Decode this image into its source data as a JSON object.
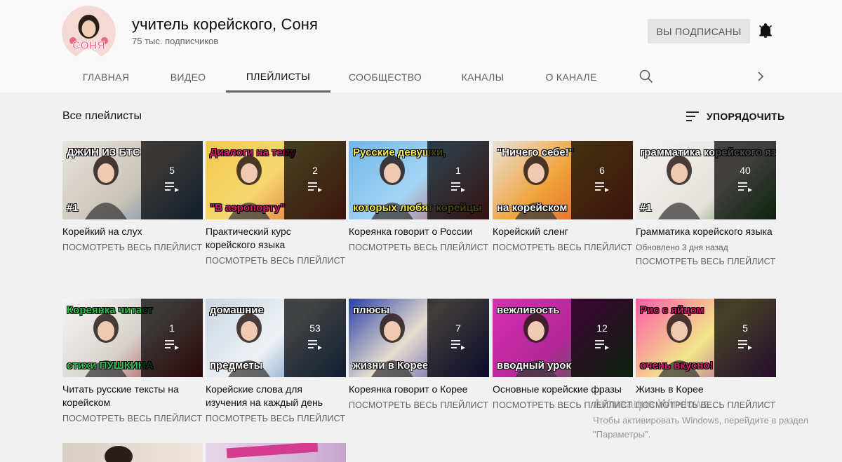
{
  "channel": {
    "name": "учитель корейского, Соня",
    "subscribers": "75 тыс. подписчиков",
    "avatar_text": "СОНЯ",
    "subscribe_label": "ВЫ ПОДПИСАНЫ"
  },
  "tabs": [
    {
      "label": "ГЛАВНАЯ"
    },
    {
      "label": "ВИДЕО"
    },
    {
      "label": "ПЛЕЙЛИСТЫ"
    },
    {
      "label": "СООБЩЕСТВО"
    },
    {
      "label": "КАНАЛЫ"
    },
    {
      "label": "О КАНАЛЕ"
    }
  ],
  "section": {
    "title": "Все плейлисты",
    "sort_label": "УПОРЯДОЧИТЬ"
  },
  "view_all_label": "ПОСМОТРЕТЬ ВЕСЬ ПЛЕЙЛИСТ",
  "playlists": [
    {
      "title": "Корейкий на слух",
      "count": "5",
      "thumb_text": "ДЖИН ИЗ БТС",
      "thumb_text2": "#1"
    },
    {
      "title": "Практический курс корейского языка",
      "count": "2",
      "thumb_text": "Диалоги на тему",
      "thumb_text2": "\"В аэропорту\""
    },
    {
      "title": "Кореянка говорит о России",
      "count": "1",
      "thumb_text": "Русские девушки,",
      "thumb_text2": "которых любят корейцы"
    },
    {
      "title": "Корейский сленг",
      "count": "6",
      "thumb_text": "\"Ничего себе!\"",
      "thumb_text2": "на корейском"
    },
    {
      "title": "Грамматика корейского языка",
      "count": "40",
      "updated": "Обновлено 3 дня назад",
      "thumb_text": "грамматика корейского языка",
      "thumb_text2": "#1"
    },
    {
      "title": "Читать русские тексты на корейском",
      "count": "1",
      "thumb_text": "Кореянка читает",
      "thumb_text2": "стихи ПУШКИНА"
    },
    {
      "title": "Корейские слова для изучения на каждый день",
      "count": "53",
      "thumb_text": "домашние",
      "thumb_text2": "предметы"
    },
    {
      "title": "Кореянка говорит о Корее",
      "count": "7",
      "thumb_text": "плюсы",
      "thumb_text2": "жизни в Корее"
    },
    {
      "title": "Основные корейские фразы",
      "count": "12",
      "thumb_text": "вежливость",
      "thumb_text2": "вводный урок"
    },
    {
      "title": "Жизнь в Корее",
      "count": "5",
      "thumb_text": "Рис с яйцом",
      "thumb_text2": "очень вкусно!"
    }
  ],
  "watermark": {
    "line1": "Активация Windows",
    "line2": "Чтобы активировать Windows, перейдите в раздел \"Параметры\"."
  },
  "colors": {
    "accent": "#606060",
    "background": "#f1f1f1"
  }
}
